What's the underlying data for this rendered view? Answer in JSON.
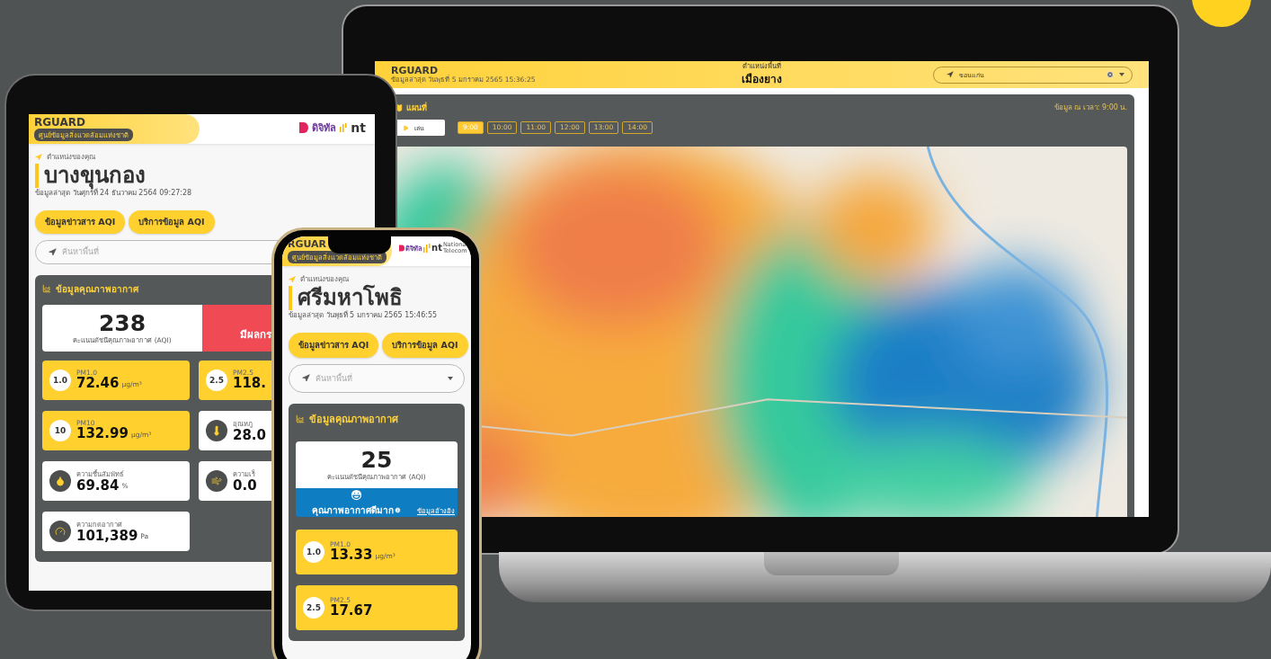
{
  "laptop": {
    "header": {
      "brand": "RGUARD",
      "updated": "ข้อมูลล่าสุด วันพุธที่ 5 มกราคม 2565 15:36:25",
      "area_label": "ตำแหน่งพื้นที่",
      "area": "เมืองยาง",
      "search_value": "ขอนแก่น"
    },
    "map_panel": {
      "title": "แผนที่",
      "timestamp": "ข้อมูล ณ เวลา: 9:00 น.",
      "play": "เล่น",
      "times": [
        {
          "label": "9:00",
          "selected": true
        },
        {
          "label": "10:00",
          "selected": false
        },
        {
          "label": "11:00",
          "selected": false
        },
        {
          "label": "12:00",
          "selected": false
        },
        {
          "label": "13:00",
          "selected": false
        },
        {
          "label": "14:00",
          "selected": false
        }
      ]
    }
  },
  "tablet": {
    "brand": "RGUARD",
    "subtitle": "ศูนย์ข้อมูลสิ่งแวดล้อมแห่งชาติ",
    "logo_text": "ดิจิทัล",
    "logo_nt": "nt",
    "location_label": "ตำแหน่งของคุณ",
    "location": "บางขุนกอง",
    "updated": "ข้อมูลล่าสุด วันศุกร์ที่ 24 ธันวาคม 2564 09:27:28",
    "buttons": [
      "ข้อมูลข่าวสาร AQI",
      "บริการข้อมูล AQI"
    ],
    "search_placeholder": "ค้นหาพื้นที่",
    "panel_title": "ข้อมูลคุณภาพอากาศ",
    "aqi": {
      "value": "238",
      "label": "คะแนนดัชนีคุณภาพอากาศ (AQI)",
      "status": "มีผลกร",
      "color": "#f04a55"
    },
    "tiles": [
      {
        "kind": "pm",
        "badge": "1.0",
        "label": "PM1.0",
        "value": "72.46",
        "unit": "µg/m³"
      },
      {
        "kind": "pm",
        "badge": "2.5",
        "label": "PM2.5",
        "value": "118."
      },
      {
        "kind": "pm",
        "badge": "10",
        "label": "PM10",
        "value": "132.99",
        "unit": "µg/m³"
      },
      {
        "kind": "temperature",
        "label": "อุณหภู",
        "value": "28.0"
      },
      {
        "kind": "humidity",
        "label": "ความชื้นสัมพัทธ์",
        "value": "69.84",
        "unit": "%"
      },
      {
        "kind": "wind",
        "label": "ความเร็",
        "value": "0.0"
      },
      {
        "kind": "pressure",
        "label": "ความกดอากาศ",
        "value": "101,389",
        "unit": "Pa"
      }
    ]
  },
  "phone": {
    "brand": "RGUAR",
    "subtitle": "ศูนย์ข้อมูลสิ่งแวดล้อมแห่งชาติ",
    "logo_text": "ดิจิทัล",
    "logo_nt": "nt",
    "logo_nt_caption": "National Telecom",
    "location_label": "ตำแหน่งของคุณ",
    "location": "ศรีมหาโพธิ",
    "updated": "ข้อมูลล่าสุด วันพุธที่ 5 มกราคม 2565 15:46:55",
    "buttons": [
      "ข้อมูลข่าวสาร AQI",
      "บริการข้อมูล AQI"
    ],
    "search_placeholder": "ค้นหาพื้นที่",
    "panel_title": "ข้อมูลคุณภาพอากาศ",
    "aqi": {
      "value": "25",
      "label": "คะแนนดัชนีคุณภาพอากาศ (AQI)",
      "status": "คุณภาพอากาศดีมาก",
      "color": "#0f7dc2",
      "link": "ข้อมูลอ้างอิง"
    },
    "tiles": [
      {
        "kind": "pm",
        "badge": "1.0",
        "label": "PM1.0",
        "value": "13.33",
        "unit": "µg/m³"
      },
      {
        "kind": "pm",
        "badge": "2.5",
        "label": "PM2.5",
        "value": "17.67"
      }
    ]
  }
}
